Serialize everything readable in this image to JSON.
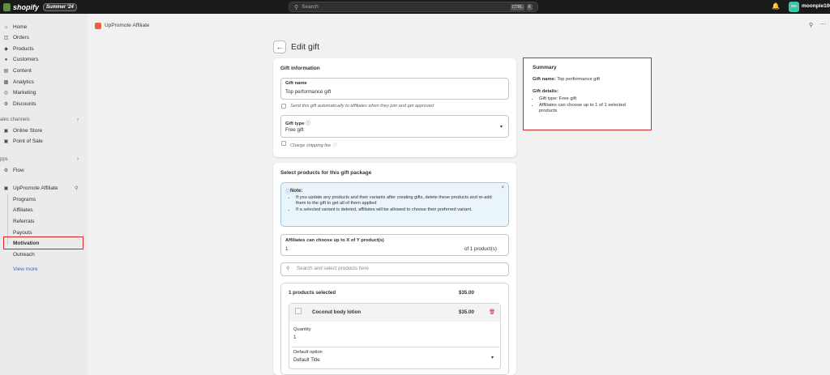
{
  "topbar": {
    "brand": "shopify",
    "edition_badge": "Summer '24",
    "search_placeholder": "Search",
    "shortcut_ctrl": "CTRL",
    "shortcut_k": "K",
    "username": "moonpie106",
    "avatar_initials": "mo"
  },
  "sidebar": {
    "main_items": [
      "Home",
      "Orders",
      "Products",
      "Customers",
      "Content",
      "Analytics",
      "Marketing",
      "Discounts"
    ],
    "sales_channels_label": "ales channels",
    "sales_channels": [
      "Online Store",
      "Point of Sale"
    ],
    "apps_label": "pps",
    "apps": [
      "Flow"
    ],
    "app_name": "UpPromote Affiliate",
    "app_sub_items": [
      "Programs",
      "Affiliates",
      "Referrals",
      "Payouts",
      "Motivation",
      "Outreach"
    ],
    "view_more": "View more"
  },
  "app_header": {
    "title": "UpPromote Affiliate"
  },
  "page": {
    "title": "Edit gift"
  },
  "gift_info": {
    "heading": "Gift information",
    "name_label": "Gift name",
    "name_value": "Top performance gift",
    "auto_send_label": "Send this gift automatically to affiliates when they join and get approved",
    "type_label": "Gift type",
    "type_value": "Free gift",
    "shipping_label": "Charge shipping fee"
  },
  "products": {
    "heading": "Select products for this gift package",
    "note_title": "Note:",
    "note_items": [
      "If you update any products and their variants after creating gifts, delete these products and re-add them to the gift to get all of them applied",
      "If a selected variant is deleted, affiliates will be allowed to choose their preferred variant."
    ],
    "limit_label": "Affiliates can choose up to X of Y product(s)",
    "limit_value": "1",
    "limit_suffix": "of 1 product(s)",
    "search_placeholder": "Search and select products here",
    "selected_count": "1 products selected",
    "selected_total": "$35.00",
    "item_name": "Coconut body lotion",
    "item_price": "$35.00",
    "quantity_label": "Quantity",
    "quantity_value": "1",
    "default_option_label": "Default option",
    "default_option_value": "Default Title"
  },
  "summary": {
    "heading": "Summary",
    "gift_name_label": "Gift name:",
    "gift_name_value": "Top performance gift",
    "details_label": "Gift details:",
    "details": [
      "Gift type: Free gift",
      "Affiliates can choose up to 1 of 1 selected products"
    ]
  },
  "colors": {
    "highlight": "#d5252b",
    "topbar": "#1a1a1a",
    "note_bg": "#eaf4fb",
    "link": "#2c6ecb"
  }
}
